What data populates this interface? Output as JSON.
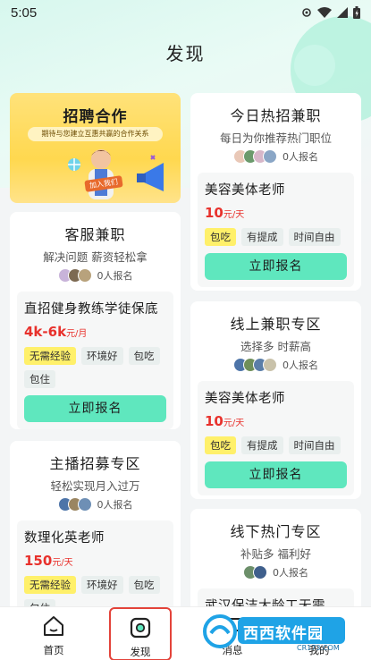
{
  "status_bar": {
    "time": "5:05"
  },
  "header": {
    "title": "发现"
  },
  "banner": {
    "title": "招聘合作",
    "subtitle": "期待与您建立互惠共赢的合作关系",
    "cta": "加入我们"
  },
  "left_sections": [
    {
      "title": "客服兼职",
      "subtitle": "解决问题 薪资轻松拿",
      "signup": "0人报名",
      "job": {
        "title": "直招健身教练学徒保底",
        "salary": "4k-6k",
        "salary_unit": "元/月",
        "tags": [
          "无需经验",
          "环境好",
          "包吃",
          "包住"
        ],
        "highlight_tags": [
          0
        ],
        "apply": "立即报名"
      }
    },
    {
      "title": "主播招募专区",
      "subtitle": "轻松实现月入过万",
      "signup": "0人报名",
      "job": {
        "title": "数理化英老师",
        "salary": "150",
        "salary_unit": "元/天",
        "tags": [
          "无需经验",
          "环境好",
          "包吃",
          "包住"
        ],
        "highlight_tags": [
          0
        ]
      }
    }
  ],
  "right_sections": [
    {
      "title": "今日热招兼职",
      "subtitle": "每日为你推荐热门职位",
      "signup": "0人报名",
      "job": {
        "title": "美容美体老师",
        "salary": "10",
        "salary_unit": "元/天",
        "tags": [
          "包吃",
          "有提成",
          "时间自由"
        ],
        "highlight_tags": [
          0
        ],
        "apply": "立即报名"
      }
    },
    {
      "title": "线上兼职专区",
      "subtitle": "选择多 时薪高",
      "signup": "0人报名",
      "job": {
        "title": "美容美体老师",
        "salary": "10",
        "salary_unit": "元/天",
        "tags": [
          "包吃",
          "有提成",
          "时间自由"
        ],
        "highlight_tags": [
          0
        ],
        "apply": "立即报名"
      }
    },
    {
      "title": "线下热门专区",
      "subtitle": "补贴多 福利好",
      "signup": "0人报名",
      "job": {
        "title": "武汉保洁大龄工无需"
      }
    }
  ],
  "nav": {
    "items": [
      {
        "label": "首页",
        "icon": "home-icon"
      },
      {
        "label": "发现",
        "icon": "discover-icon"
      },
      {
        "label": "消息",
        "icon": "message-icon"
      },
      {
        "label": "我的",
        "icon": "profile-icon"
      }
    ],
    "active": 1
  },
  "watermark": {
    "text": "西西软件园",
    "sub": "CR173.COM"
  },
  "colors": {
    "accent": "#5fe7be",
    "salary": "#e8312c",
    "tag_highlight": "#fff06a",
    "active_outline": "#e3433a"
  }
}
